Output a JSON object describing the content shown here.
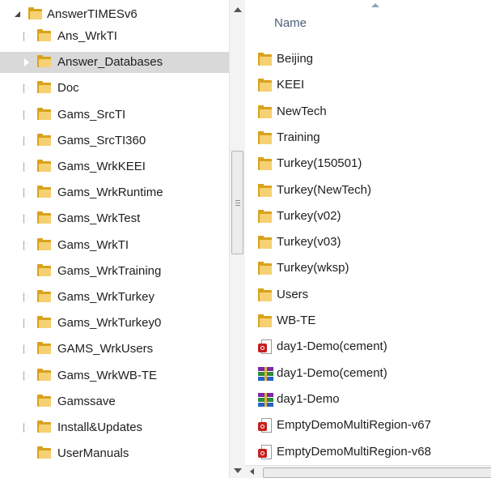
{
  "tree": {
    "root": "AnswerTIMESv6",
    "items": [
      {
        "label": "Ans_WrkTI",
        "expandable": true
      },
      {
        "label": "Answer_Databases",
        "expandable": true,
        "selected": true
      },
      {
        "label": "Doc",
        "expandable": true
      },
      {
        "label": "Gams_SrcTI",
        "expandable": true
      },
      {
        "label": "Gams_SrcTI360",
        "expandable": true
      },
      {
        "label": "Gams_WrkKEEI",
        "expandable": true
      },
      {
        "label": "Gams_WrkRuntime",
        "expandable": true
      },
      {
        "label": "Gams_WrkTest",
        "expandable": true
      },
      {
        "label": "Gams_WrkTI",
        "expandable": true
      },
      {
        "label": "Gams_WrkTraining",
        "expandable": false
      },
      {
        "label": "Gams_WrkTurkey",
        "expandable": true
      },
      {
        "label": "Gams_WrkTurkey0",
        "expandable": true
      },
      {
        "label": "GAMS_WrkUsers",
        "expandable": true
      },
      {
        "label": "Gams_WrkWB-TE",
        "expandable": true
      },
      {
        "label": "Gamssave",
        "expandable": false
      },
      {
        "label": "Install&Updates",
        "expandable": true
      },
      {
        "label": "UserManuals",
        "expandable": false
      }
    ]
  },
  "content": {
    "column_header": "Name",
    "files": [
      {
        "name": "Beijing",
        "type": "folder"
      },
      {
        "name": "KEEI",
        "type": "folder"
      },
      {
        "name": "NewTech",
        "type": "folder"
      },
      {
        "name": "Training",
        "type": "folder"
      },
      {
        "name": "Turkey(150501)",
        "type": "folder"
      },
      {
        "name": "Turkey(NewTech)",
        "type": "folder"
      },
      {
        "name": "Turkey(v02)",
        "type": "folder"
      },
      {
        "name": "Turkey(v03)",
        "type": "folder"
      },
      {
        "name": "Turkey(wksp)",
        "type": "folder"
      },
      {
        "name": "Users",
        "type": "folder"
      },
      {
        "name": "WB-TE",
        "type": "folder"
      },
      {
        "name": "day1-Demo(cement)",
        "type": "pdf"
      },
      {
        "name": "day1-Demo(cement)",
        "type": "archive"
      },
      {
        "name": "day1-Demo",
        "type": "archive"
      },
      {
        "name": "EmptyDemoMultiRegion-v67",
        "type": "pdf"
      },
      {
        "name": "EmptyDemoMultiRegion-v68",
        "type": "pdf"
      }
    ]
  },
  "colors": {
    "folder": "#f5d173",
    "folder_dark": "#d9a21d",
    "selected_row": "#d9d9d9",
    "header_text": "#4c607a",
    "pdf_badge": "#c5201f"
  }
}
